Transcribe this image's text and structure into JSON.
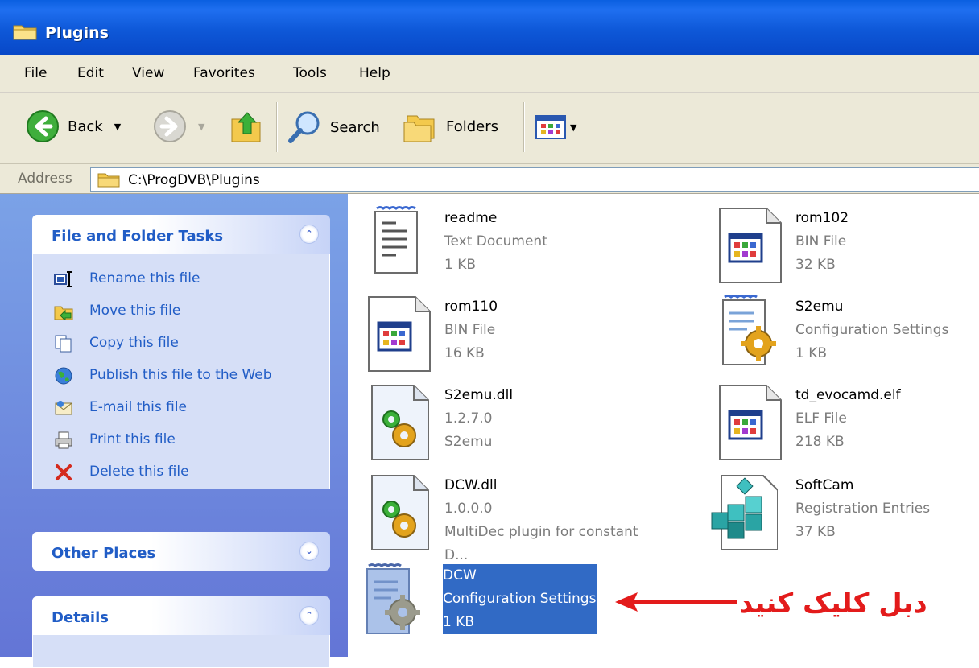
{
  "window": {
    "title": "Plugins"
  },
  "menu": [
    "File",
    "Edit",
    "View",
    "Favorites",
    "Tools",
    "Help"
  ],
  "toolbar": {
    "back_label": "Back",
    "search_label": "Search",
    "folders_label": "Folders"
  },
  "address": {
    "label": "Address",
    "path": "C:\\ProgDVB\\Plugins"
  },
  "tasks_panel": {
    "title": "File and Folder Tasks",
    "items": [
      {
        "label": "Rename this file",
        "icon": "rename-icon"
      },
      {
        "label": "Move this file",
        "icon": "move-icon"
      },
      {
        "label": "Copy this file",
        "icon": "copy-icon"
      },
      {
        "label": "Publish this file to the Web",
        "icon": "publish-web-icon"
      },
      {
        "label": "E-mail this file",
        "icon": "email-icon"
      },
      {
        "label": "Print this file",
        "icon": "print-icon"
      },
      {
        "label": "Delete this file",
        "icon": "delete-icon"
      }
    ]
  },
  "other_places": {
    "title": "Other Places"
  },
  "details": {
    "title": "Details"
  },
  "files": [
    {
      "name": "readme",
      "line2": "Text Document",
      "line3": "1 KB",
      "icon": "text-document-icon"
    },
    {
      "name": "rom102",
      "line2": "BIN File",
      "line3": "32 KB",
      "icon": "bin-file-icon"
    },
    {
      "name": "rom110",
      "line2": "BIN File",
      "line3": "16 KB",
      "icon": "bin-file-icon"
    },
    {
      "name": "S2emu",
      "line2": "Configuration Settings",
      "line3": "1 KB",
      "icon": "config-settings-icon"
    },
    {
      "name": "S2emu.dll",
      "line2": "1.2.7.0",
      "line3": "S2emu",
      "icon": "dll-icon"
    },
    {
      "name": "td_evocamd.elf",
      "line2": "ELF File",
      "line3": "218 KB",
      "icon": "elf-file-icon"
    },
    {
      "name": "DCW.dll",
      "line2": "1.0.0.0",
      "line3": "MultiDec plugin for constant D...",
      "icon": "dll-icon"
    },
    {
      "name": "SoftCam",
      "line2": "Registration Entries",
      "line3": "37 KB",
      "icon": "registry-icon"
    },
    {
      "name": "DCW",
      "line2": "Configuration Settings",
      "line3": "1 KB",
      "icon": "config-settings-icon",
      "selected": true
    }
  ],
  "annotation": {
    "text": "دبل کلیک کنید",
    "color": "#e31b1b"
  },
  "colors": {
    "title_bar": "#0a5fe0",
    "task_link": "#215dc6",
    "selection": "#316ac5",
    "pane": "#6f8fe0"
  }
}
